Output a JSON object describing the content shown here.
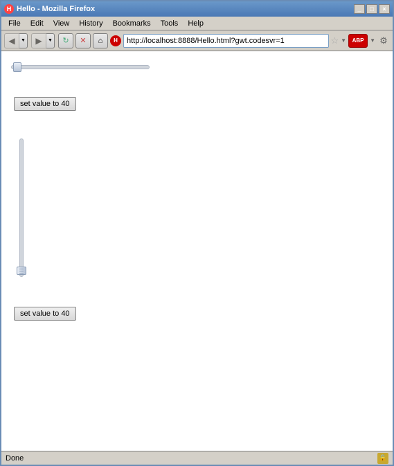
{
  "browser": {
    "title": "Hello - Mozilla Firefox",
    "title_icon": "H",
    "title_buttons": [
      "_",
      "□",
      "×"
    ]
  },
  "menu": {
    "items": [
      "File",
      "Edit",
      "View",
      "History",
      "Bookmarks",
      "Tools",
      "Help"
    ]
  },
  "nav": {
    "url": "http://localhost:8888/Hello.html?gwt.codesvr=1",
    "favicon": "H",
    "settings_icon": "⚙",
    "adblock_label": "ABP"
  },
  "content": {
    "h_slider_value": 0,
    "button1_label": "set value to 40",
    "button2_label": "set value to 40",
    "v_slider_value": 0
  },
  "statusbar": {
    "text": "Done"
  }
}
